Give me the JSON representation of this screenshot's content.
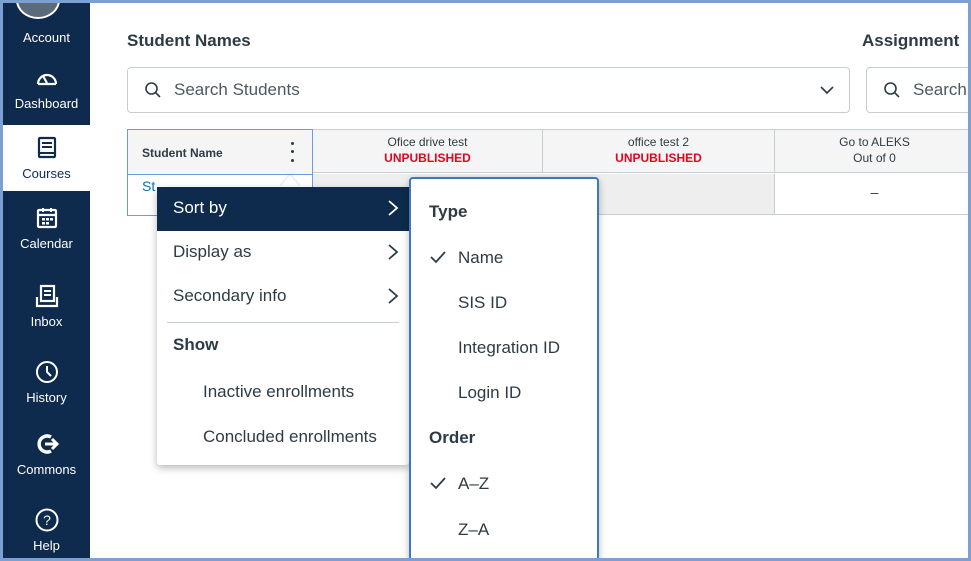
{
  "nav": {
    "items": [
      {
        "label": "Account",
        "icon": "account-avatar-icon"
      },
      {
        "label": "Dashboard",
        "icon": "dashboard-icon"
      },
      {
        "label": "Courses",
        "icon": "courses-icon"
      },
      {
        "label": "Calendar",
        "icon": "calendar-icon"
      },
      {
        "label": "Inbox",
        "icon": "inbox-icon"
      },
      {
        "label": "History",
        "icon": "history-icon"
      },
      {
        "label": "Commons",
        "icon": "commons-icon"
      },
      {
        "label": "Help",
        "icon": "help-icon"
      }
    ],
    "active": "Courses",
    "colors": {
      "background": "#0e2a4c",
      "text": "#ffffff"
    }
  },
  "student_names": {
    "title": "Student Names",
    "search_placeholder": "Search Students"
  },
  "assignment": {
    "title": "Assignment",
    "search_placeholder": "Search"
  },
  "grid": {
    "name_header": "Student Name",
    "name_cell": "St",
    "columns": [
      {
        "title": "Ofice drive test",
        "status": "UNPUBLISHED"
      },
      {
        "title": "office test 2",
        "status": "UNPUBLISHED"
      },
      {
        "title": "Go to ALEKS",
        "status": "Out of 0"
      }
    ],
    "row_values": [
      "",
      "",
      "–"
    ],
    "colors": {
      "unpublished": "#e0061f",
      "link": "#0374b5"
    }
  },
  "menu": {
    "sort_by": "Sort by",
    "display_as": "Display as",
    "secondary_info": "Secondary info",
    "show_heading": "Show",
    "inactive_enrollments": "Inactive enrollments",
    "concluded_enrollments": "Concluded enrollments"
  },
  "submenu": {
    "type_heading": "Type",
    "name": "Name",
    "sis_id": "SIS ID",
    "integration_id": "Integration ID",
    "login_id": "Login ID",
    "order_heading": "Order",
    "a_z": "A–Z",
    "z_a": "Z–A",
    "checked": [
      "Name",
      "A–Z"
    ]
  }
}
